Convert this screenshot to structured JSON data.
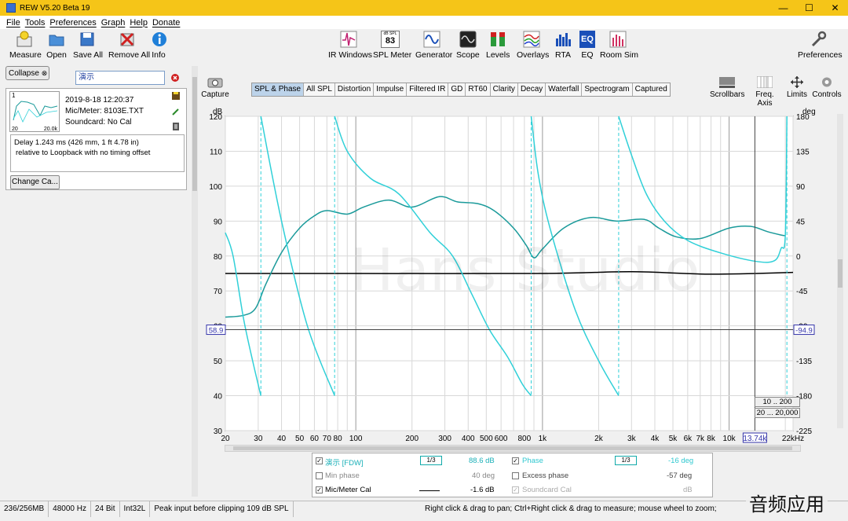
{
  "window": {
    "title": "REW V5.20 Beta 19",
    "controls": [
      "—",
      "☐",
      "✕"
    ]
  },
  "menu": [
    "File",
    "Tools",
    "Preferences",
    "Graph",
    "Help",
    "Donate"
  ],
  "toolbar": {
    "left": [
      "Measure",
      "Open",
      "Save All",
      "Remove All",
      "Info"
    ],
    "center": [
      "IR Windows",
      "SPL Meter",
      "Generator",
      "Scope",
      "Levels",
      "Overlays",
      "RTA",
      "EQ",
      "Room Sim"
    ],
    "right": [
      "Preferences"
    ],
    "spl_meter_badge": "83",
    "spl_meter_badge_top": "dB SPL",
    "eq_badge": "EQ"
  },
  "left_panel": {
    "collapse_label": "Collapse",
    "measurement_name": "演示",
    "thumb_index": "1",
    "thumb_axis_left": "20",
    "thumb_axis_right": "20.0k",
    "date": "2019-8-18 12:20:37",
    "mic_meter": "Mic/Meter: 8103E.TXT",
    "soundcard": "Soundcard: No Cal",
    "delay_line1": "Delay 1.243 ms (426 mm, 1 ft 4.78 in)",
    "delay_line2": "relative to Loopback with no timing offset",
    "change_cal_label": "Change Ca..."
  },
  "graph": {
    "capture_label": "Capture",
    "tabs": [
      "SPL & Phase",
      "All SPL",
      "Distortion",
      "Impulse",
      "Filtered IR",
      "GD",
      "RT60",
      "Clarity",
      "Decay",
      "Waterfall",
      "Spectrogram",
      "Captured"
    ],
    "active_tab": "SPL & Phase",
    "right_buttons": [
      "Scrollbars",
      "Freq. Axis",
      "Limits",
      "Controls"
    ],
    "left_axis_unit": "dB",
    "right_axis_unit": "deg",
    "left_ticks": [
      "120",
      "110",
      "100",
      "90",
      "80",
      "70",
      "60",
      "50",
      "40",
      "30"
    ],
    "right_ticks": [
      "180",
      "135",
      "90",
      "45",
      "0",
      "-45",
      "-90",
      "-135",
      "-180",
      "-225"
    ],
    "x_ticks": [
      "20",
      "30",
      "40",
      "50",
      "60",
      "70",
      "80",
      "100",
      "200",
      "300",
      "400",
      "500",
      "600",
      "800",
      "1k",
      "2k",
      "3k",
      "4k",
      "5k",
      "6k",
      "7k",
      "8k",
      "10k",
      "13.74k",
      "22kHz"
    ],
    "cursor_left_value": "58.9",
    "cursor_right_value": "-94.9",
    "cursor_freq": "13.74k",
    "range_btn1": "10 .. 200",
    "range_btn2": "20 ... 20,000",
    "watermark": "Hans Studio",
    "colors": {
      "spl": "#1a9a9a",
      "phase": "#30d0d8",
      "mic_cal": "#000000",
      "cursor_box": "#3333aa"
    }
  },
  "legend": {
    "spl_name": "演示 [FDW]",
    "spl_smoothing": "1/3",
    "spl_value": "88.6 dB",
    "phase_name": "Phase",
    "phase_smoothing": "1/3",
    "phase_value": "-16 deg",
    "min_phase_name": "Min phase",
    "min_phase_value": "40 deg",
    "excess_phase_name": "Excess phase",
    "excess_phase_value": "-57 deg",
    "mic_cal_name": "Mic/Meter Cal",
    "mic_cal_value": "-1.6 dB",
    "soundcard_cal_name": "Soundcard Cal",
    "soundcard_cal_value": "dB"
  },
  "status": {
    "memory": "236/256MB",
    "rate": "48000 Hz",
    "bits": "24 Bit",
    "format": "Int32L",
    "peak": "Peak input before clipping 109 dB SPL",
    "hint": "Right click & drag to pan; Ctrl+Right click & drag to measure; mouse wheel to zoom;"
  },
  "overlay_text": "音频应用"
}
